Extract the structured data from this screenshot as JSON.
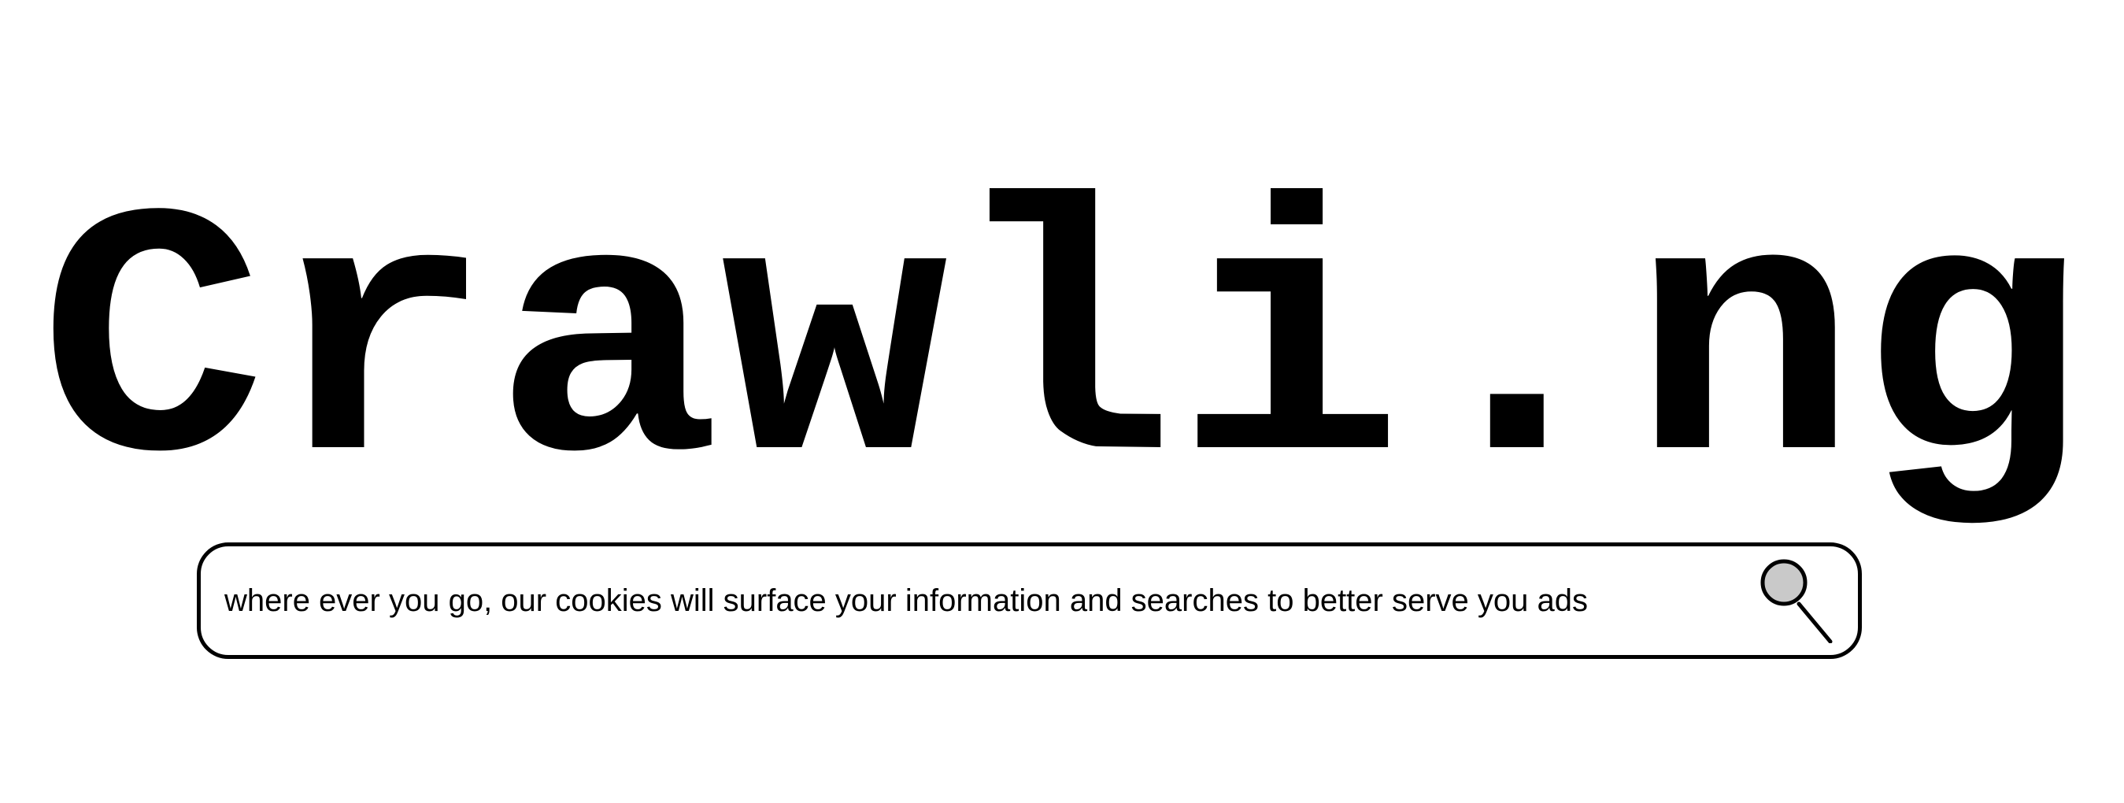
{
  "logo": {
    "text": "Crawli.ng"
  },
  "search": {
    "value": "where ever you go,  our cookies will surface your information and searches to better serve you ads",
    "button_icon": "magnifier-icon",
    "lens_color": "#c9c9c9"
  },
  "colors": {
    "ink": "#000000",
    "background": "#ffffff"
  }
}
